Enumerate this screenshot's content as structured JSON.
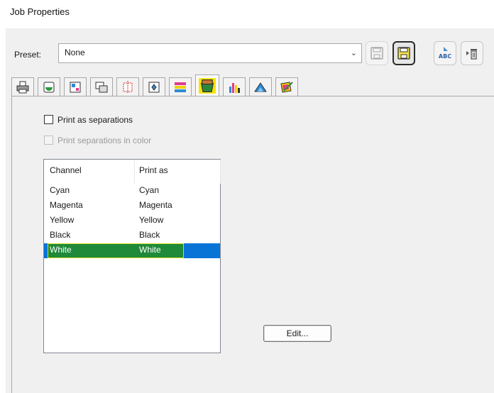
{
  "window": {
    "title": "Job Properties"
  },
  "preset": {
    "label": "Preset:",
    "value": "None"
  },
  "toolbar": {
    "buttons": [
      {
        "icon": "save-disabled-icon"
      },
      {
        "icon": "save-as-icon"
      },
      {
        "icon": "rename-icon",
        "text": "ABC"
      },
      {
        "icon": "delete-icon"
      }
    ]
  },
  "tabs": [
    {
      "icon": "printer-icon"
    },
    {
      "icon": "media-icon"
    },
    {
      "icon": "layout-icon"
    },
    {
      "icon": "scale-icon"
    },
    {
      "icon": "marks-icon"
    },
    {
      "icon": "position-icon"
    },
    {
      "icon": "color-adjust-icon"
    },
    {
      "icon": "separations-icon",
      "selected": true
    },
    {
      "icon": "ink-channels-icon"
    },
    {
      "icon": "profile-icon"
    },
    {
      "icon": "color-correction-icon"
    }
  ],
  "options": {
    "print_as_separations": {
      "label": "Print as separations",
      "checked": false
    },
    "print_separations_in_color": {
      "label": "Print separations in color",
      "checked": false,
      "disabled": true
    }
  },
  "channel_table": {
    "headers": {
      "channel": "Channel",
      "print_as": "Print as"
    },
    "rows": [
      {
        "channel": "Cyan",
        "print_as": "Cyan"
      },
      {
        "channel": "Magenta",
        "print_as": "Magenta"
      },
      {
        "channel": "Yellow",
        "print_as": "Yellow"
      },
      {
        "channel": "Black",
        "print_as": "Black"
      },
      {
        "channel": "White",
        "print_as": "White",
        "selected": true
      }
    ]
  },
  "edit_button": {
    "label": "Edit..."
  },
  "colors": {
    "selection": "#0a74d6",
    "highlight": "#1e8a3a",
    "highlight_border": "#d6df26",
    "window_bg": "#f0f0f0"
  }
}
